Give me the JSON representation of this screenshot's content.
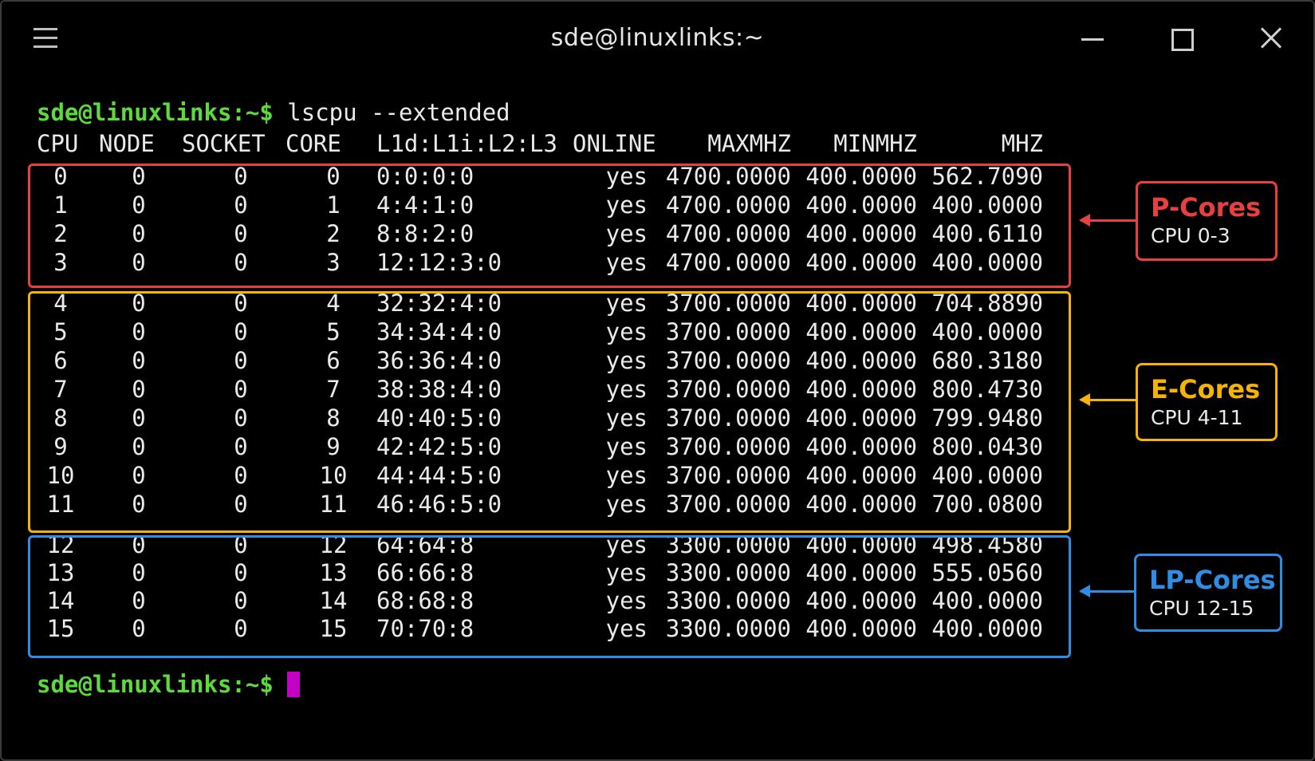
{
  "window": {
    "title": "sde@linuxlinks:~"
  },
  "terminal": {
    "prompt": "sde@linuxlinks:~$",
    "command": "lscpu --extended",
    "headers": [
      "CPU",
      "NODE",
      "SOCKET",
      "CORE",
      "L1d:L1i:L2:L3",
      "ONLINE",
      "MAXMHZ",
      "MINMHZ",
      "MHZ"
    ],
    "rows": [
      [
        "0",
        "0",
        "0",
        "0",
        "0:0:0:0",
        "yes",
        "4700.0000",
        "400.0000",
        "562.7090"
      ],
      [
        "1",
        "0",
        "0",
        "1",
        "4:4:1:0",
        "yes",
        "4700.0000",
        "400.0000",
        "400.0000"
      ],
      [
        "2",
        "0",
        "0",
        "2",
        "8:8:2:0",
        "yes",
        "4700.0000",
        "400.0000",
        "400.6110"
      ],
      [
        "3",
        "0",
        "0",
        "3",
        "12:12:3:0",
        "yes",
        "4700.0000",
        "400.0000",
        "400.0000"
      ],
      [
        "4",
        "0",
        "0",
        "4",
        "32:32:4:0",
        "yes",
        "3700.0000",
        "400.0000",
        "704.8890"
      ],
      [
        "5",
        "0",
        "0",
        "5",
        "34:34:4:0",
        "yes",
        "3700.0000",
        "400.0000",
        "400.0000"
      ],
      [
        "6",
        "0",
        "0",
        "6",
        "36:36:4:0",
        "yes",
        "3700.0000",
        "400.0000",
        "680.3180"
      ],
      [
        "7",
        "0",
        "0",
        "7",
        "38:38:4:0",
        "yes",
        "3700.0000",
        "400.0000",
        "800.4730"
      ],
      [
        "8",
        "0",
        "0",
        "8",
        "40:40:5:0",
        "yes",
        "3700.0000",
        "400.0000",
        "799.9480"
      ],
      [
        "9",
        "0",
        "0",
        "9",
        "42:42:5:0",
        "yes",
        "3700.0000",
        "400.0000",
        "800.0430"
      ],
      [
        "10",
        "0",
        "0",
        "10",
        "44:44:5:0",
        "yes",
        "3700.0000",
        "400.0000",
        "400.0000"
      ],
      [
        "11",
        "0",
        "0",
        "11",
        "46:46:5:0",
        "yes",
        "3700.0000",
        "400.0000",
        "700.0800"
      ],
      [
        "12",
        "0",
        "0",
        "12",
        "64:64:8",
        "yes",
        "3300.0000",
        "400.0000",
        "498.4580"
      ],
      [
        "13",
        "0",
        "0",
        "13",
        "66:66:8",
        "yes",
        "3300.0000",
        "400.0000",
        "555.0560"
      ],
      [
        "14",
        "0",
        "0",
        "14",
        "68:68:8",
        "yes",
        "3300.0000",
        "400.0000",
        "400.0000"
      ],
      [
        "15",
        "0",
        "0",
        "15",
        "70:70:8",
        "yes",
        "3300.0000",
        "400.0000",
        "400.0000"
      ]
    ]
  },
  "annotations": {
    "p_cores": {
      "title": "P-Cores",
      "subtitle": "CPU 0-3",
      "color": "#e8403f"
    },
    "e_cores": {
      "title": "E-Cores",
      "subtitle": "CPU 4-11",
      "color": "#f4b400"
    },
    "lp_cores": {
      "title": "LP-Cores",
      "subtitle": "CPU 12-15",
      "color": "#2f8de4"
    }
  },
  "colors": {
    "prompt": "#5ddb3c",
    "cursor": "#c400c4",
    "background": "#000000",
    "text": "#eaeaea"
  },
  "icons": [
    "hamburger-menu-icon",
    "minimize-icon",
    "maximize-icon",
    "close-icon"
  ]
}
